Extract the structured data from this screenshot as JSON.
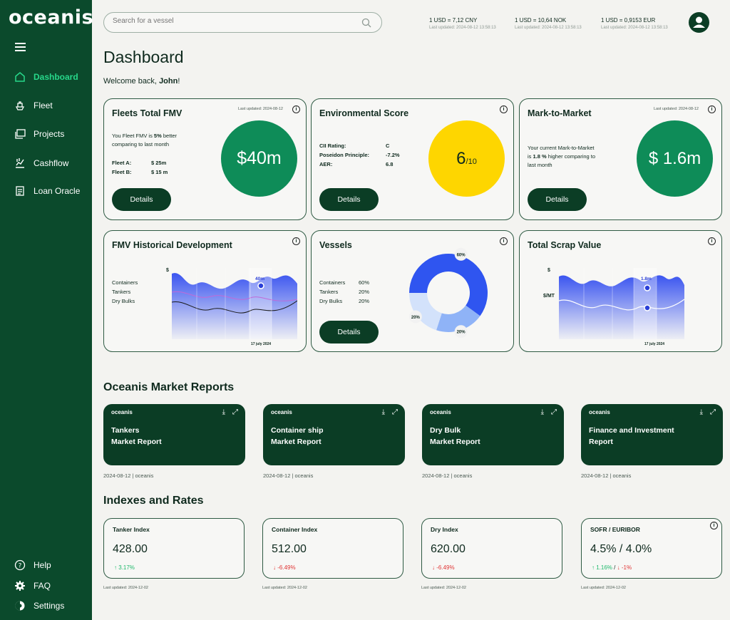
{
  "app": {
    "logo": "oceanis"
  },
  "sidebar": {
    "items": [
      {
        "label": "Dashboard",
        "icon": "home-icon",
        "active": true
      },
      {
        "label": "Fleet",
        "icon": "ship-icon"
      },
      {
        "label": "Projects",
        "icon": "folders-icon"
      },
      {
        "label": "Cashflow",
        "icon": "cashflow-icon"
      },
      {
        "label": "Loan Oracle",
        "icon": "document-icon"
      }
    ],
    "bottom": [
      {
        "label": "Help",
        "icon": "help-icon"
      },
      {
        "label": "FAQ",
        "icon": "gear-icon"
      },
      {
        "label": "Settings",
        "icon": "settings-icon"
      }
    ]
  },
  "search": {
    "placeholder": "Search for a vessel"
  },
  "rates": [
    {
      "main": "1 USD = 7,12 CNY",
      "sub": "Last updated: 2024-08-12 13:58:13"
    },
    {
      "main": "1 USD = 10,64 NOK",
      "sub": "Last updated: 2024-08-12 13:58:13"
    },
    {
      "main": "1 USD = 0,9153 EUR",
      "sub": "Last updated: 2024-08-12 13:58:13"
    }
  ],
  "page": {
    "title": "Dashboard",
    "welcome_prefix": "Welcome back, ",
    "user": "John",
    "welcome_suffix": "!"
  },
  "cards": {
    "fmv": {
      "title": "Fleets Total FMV",
      "updated": "Last updated: 2024-08-12",
      "line1_prefix": "You Fleet FMV is ",
      "line1_bold": "5%",
      "line1_suffix": " better",
      "line2": "comparing to last month",
      "fleet_a_label": "Fleet A:",
      "fleet_a_value": "$ 25m",
      "fleet_b_label": "Fleet B:",
      "fleet_b_value": "$ 15 m",
      "value": "$40m",
      "button": "Details"
    },
    "env": {
      "title": "Environmental Score",
      "rows": [
        {
          "label": "CII Rating:",
          "value": "C"
        },
        {
          "label": "Poseidon Principle:",
          "value": "-7.2%"
        },
        {
          "label": "AER:",
          "value": "6.8"
        }
      ],
      "score": "6",
      "score_of": "/10",
      "button": "Details"
    },
    "mtm": {
      "title": "Mark-to-Market",
      "updated": "Last updated: 2024-08-12",
      "line1": "Your current Mark-to-Market",
      "line2_prefix": "is ",
      "line2_bold": "1.8 %",
      "line2_suffix": " higher comparing to",
      "line3": "last month",
      "value": "$ 1.6m",
      "button": "Details"
    },
    "fmvhist": {
      "title": "FMV Historical Development",
      "legend": [
        "Containers",
        "Tankers",
        "Dry Bulks"
      ],
      "y_label": "$",
      "marker": "40m",
      "date": "17 july 2024"
    },
    "vessels": {
      "title": "Vessels",
      "rows": [
        {
          "label": "Containers",
          "value": "60%"
        },
        {
          "label": "Tankers",
          "value": "20%"
        },
        {
          "label": "Dry Bulks",
          "value": "20%"
        }
      ],
      "button": "Details"
    },
    "scrap": {
      "title": "Total Scrap Value",
      "y_label1": "$",
      "y_label2": "$/MT",
      "marker": "1.8m",
      "date": "17 july 2024"
    }
  },
  "chart_data": {
    "type": "pie",
    "categories": [
      "Containers",
      "Tankers",
      "Dry Bulks"
    ],
    "values": [
      60,
      20,
      20
    ],
    "labels": [
      "60%",
      "20%",
      "20%"
    ],
    "colors": [
      "#2f55f0",
      "#8fb3f7",
      "#d3e2fb"
    ]
  },
  "reports": {
    "title": "Oceanis Market Reports",
    "items": [
      {
        "brand": "oceanis",
        "line1": "Tankers",
        "line2": "Market Report",
        "date": "2024-08-12",
        "source": "oceanis"
      },
      {
        "brand": "oceanis",
        "line1": "Container ship",
        "line2": "Market Report",
        "date": "2024-08-12",
        "source": "oceanis"
      },
      {
        "brand": "oceanis",
        "line1": "Dry Bulk",
        "line2": "Market Report",
        "date": "2024-08-12",
        "source": "oceanis"
      },
      {
        "brand": "oceanis",
        "line1": "Finance and Investment",
        "line2": "Report",
        "date": "2024-08-12",
        "source": "oceanis"
      }
    ]
  },
  "indexes": {
    "title": "Indexes and Rates",
    "items": [
      {
        "name": "Tanker Index",
        "value": "428.00",
        "change": "3.17%",
        "dir": "up",
        "updated": "Last updated: 2024-12-02"
      },
      {
        "name": "Container Index",
        "value": "512.00",
        "change": "-6.49%",
        "dir": "down",
        "updated": "Last updated: 2024-12-02"
      },
      {
        "name": "Dry Index",
        "value": "620.00",
        "change": "-6.49%",
        "dir": "down",
        "updated": "Last updated: 2024-12-02"
      },
      {
        "name": "SOFR / EURIBOR",
        "value": "4.5% / 4.0%",
        "change": "1.16%",
        "change2": "-1%",
        "dir": "mixed",
        "updated": "Last updated: 2024-12-02"
      }
    ]
  }
}
